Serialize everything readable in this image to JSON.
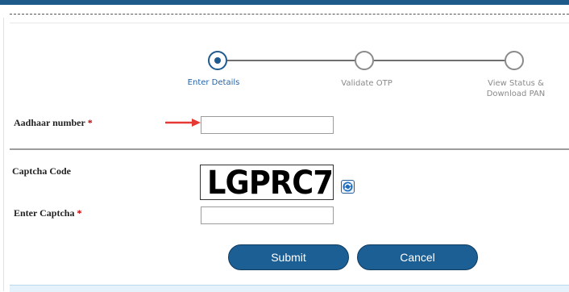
{
  "steps": [
    {
      "label_line1": "Enter Details",
      "label_line2": "",
      "state": "active"
    },
    {
      "label_line1": "Validate OTP",
      "label_line2": "",
      "state": "inactive"
    },
    {
      "label_line1": "View Status &",
      "label_line2": "Download PAN",
      "state": "inactive"
    }
  ],
  "form": {
    "aadhaar": {
      "label": "Aadhaar number",
      "required_mark": "*",
      "value": "",
      "placeholder": ""
    },
    "captcha_code": {
      "label": "Captcha Code",
      "image_text": "LGPRC7"
    },
    "enter_captcha": {
      "label": "Enter Captcha",
      "required_mark": "*",
      "value": "",
      "placeholder": ""
    }
  },
  "buttons": {
    "submit": "Submit",
    "cancel": "Cancel"
  },
  "icons": {
    "refresh": "refresh-icon",
    "arrow": "red-arrow-icon"
  },
  "colors": {
    "accent": "#1c5f95",
    "active_step": "#1f5a8f",
    "required": "#c40000",
    "arrow": "#e53935"
  }
}
